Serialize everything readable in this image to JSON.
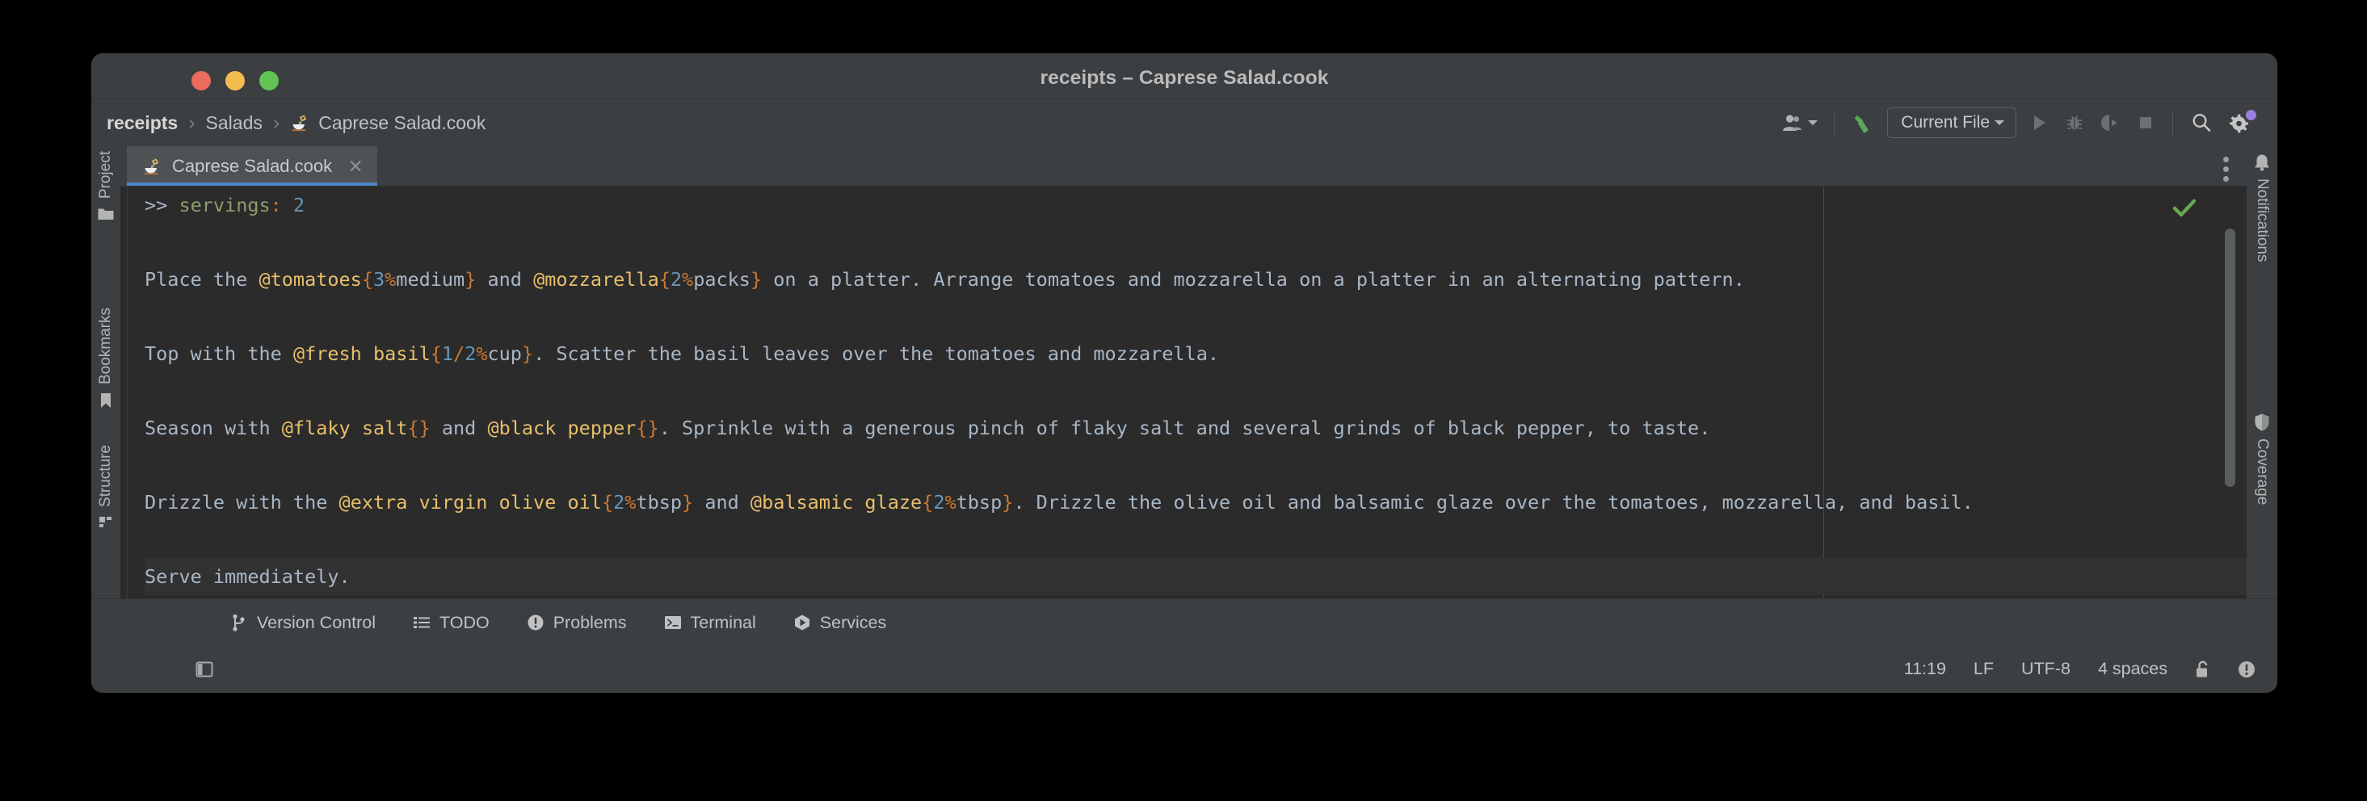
{
  "window": {
    "title": "receipts – Caprese Salad.cook",
    "controls": {
      "close": "close",
      "minimize": "minimize",
      "maximize": "maximize"
    }
  },
  "breadcrumb": {
    "items": [
      {
        "label": "receipts",
        "bold": true
      },
      {
        "label": "Salads",
        "bold": false
      },
      {
        "label": "Caprese Salad.cook",
        "bold": false,
        "icon": "cook-file-icon"
      }
    ],
    "separator": "›"
  },
  "toolbar": {
    "user_icon": "user-avatar-icon",
    "build_icon": "build-hammer-icon",
    "run_config": "Current File",
    "run_icon": "run-play-icon",
    "debug_icon": "debug-bug-icon",
    "coverage_icon": "run-with-coverage-icon",
    "stop_icon": "stop-square-icon",
    "search_icon": "search-icon",
    "settings_icon": "settings-gear-icon",
    "settings_badge_color": "#9a7de0"
  },
  "left_stripe": {
    "items": [
      {
        "label": "Project",
        "icon": "project-folder-icon"
      },
      {
        "label": "Bookmarks",
        "icon": "bookmark-icon"
      },
      {
        "label": "Structure",
        "icon": "structure-icon"
      }
    ]
  },
  "right_stripe": {
    "items": [
      {
        "label": "Notifications",
        "icon": "notification-bell-icon"
      },
      {
        "label": "Coverage",
        "icon": "coverage-shield-icon"
      }
    ]
  },
  "tabs": {
    "active": {
      "label": "Caprese Salad.cook",
      "icon": "cook-file-icon",
      "close": "✕"
    },
    "more_options": "tab-more-options-icon",
    "underline_color": "#4a88c7"
  },
  "editor": {
    "inspection_status": "ok",
    "inspection_color": "#6aa84f",
    "lines": [
      [
        {
          "t": ">> ",
          "c": "txt"
        },
        {
          "t": "servings",
          "c": "kw"
        },
        {
          "t": ":",
          "c": "punct"
        },
        {
          "t": " ",
          "c": "txt"
        },
        {
          "t": "2",
          "c": "num"
        }
      ],
      [],
      [
        {
          "t": "Place the ",
          "c": "txt"
        },
        {
          "t": "@tomatoes",
          "c": "ing"
        },
        {
          "t": "{",
          "c": "punct"
        },
        {
          "t": "3",
          "c": "num"
        },
        {
          "t": "%",
          "c": "punct"
        },
        {
          "t": "medium",
          "c": "txt"
        },
        {
          "t": "}",
          "c": "punct"
        },
        {
          "t": " and ",
          "c": "txt"
        },
        {
          "t": "@mozzarella",
          "c": "ing"
        },
        {
          "t": "{",
          "c": "punct"
        },
        {
          "t": "2",
          "c": "num"
        },
        {
          "t": "%",
          "c": "punct"
        },
        {
          "t": "packs",
          "c": "txt"
        },
        {
          "t": "}",
          "c": "punct"
        },
        {
          "t": " on a platter. Arrange tomatoes and mozzarella on a platter in an alternating pattern.",
          "c": "txt"
        }
      ],
      [],
      [
        {
          "t": "Top with the ",
          "c": "txt"
        },
        {
          "t": "@fresh basil",
          "c": "ing"
        },
        {
          "t": "{",
          "c": "punct"
        },
        {
          "t": "1",
          "c": "num"
        },
        {
          "t": "/",
          "c": "punct"
        },
        {
          "t": "2",
          "c": "num"
        },
        {
          "t": "%",
          "c": "punct"
        },
        {
          "t": "cup",
          "c": "txt"
        },
        {
          "t": "}",
          "c": "punct"
        },
        {
          "t": ". Scatter the basil leaves over the tomatoes and mozzarella.",
          "c": "txt"
        }
      ],
      [],
      [
        {
          "t": "Season with ",
          "c": "txt"
        },
        {
          "t": "@flaky salt",
          "c": "ing"
        },
        {
          "t": "{}",
          "c": "punct"
        },
        {
          "t": " and ",
          "c": "txt"
        },
        {
          "t": "@black pepper",
          "c": "ing"
        },
        {
          "t": "{}",
          "c": "punct"
        },
        {
          "t": ". Sprinkle with a generous pinch of flaky salt and several grinds of black pepper, to taste.",
          "c": "txt"
        }
      ],
      [],
      [
        {
          "t": "Drizzle with the ",
          "c": "txt"
        },
        {
          "t": "@extra virgin olive oil",
          "c": "ing"
        },
        {
          "t": "{",
          "c": "punct"
        },
        {
          "t": "2",
          "c": "num"
        },
        {
          "t": "%",
          "c": "punct"
        },
        {
          "t": "tbsp",
          "c": "txt"
        },
        {
          "t": "}",
          "c": "punct"
        },
        {
          "t": " and ",
          "c": "txt"
        },
        {
          "t": "@balsamic glaze",
          "c": "ing"
        },
        {
          "t": "{",
          "c": "punct"
        },
        {
          "t": "2",
          "c": "num"
        },
        {
          "t": "%",
          "c": "punct"
        },
        {
          "t": "tbsp",
          "c": "txt"
        },
        {
          "t": "}",
          "c": "punct"
        },
        {
          "t": ". Drizzle the olive oil and balsamic glaze over the tomatoes, mozzarella, and basil.",
          "c": "txt"
        }
      ],
      [],
      [
        {
          "t": "Serve immediately.",
          "c": "txt"
        }
      ]
    ],
    "current_line_index": 10
  },
  "bottom_bar": {
    "items": [
      {
        "label": "Version Control",
        "icon": "version-control-branch-icon"
      },
      {
        "label": "TODO",
        "icon": "todo-list-icon"
      },
      {
        "label": "Problems",
        "icon": "problems-warning-icon"
      },
      {
        "label": "Terminal",
        "icon": "terminal-prompt-icon"
      },
      {
        "label": "Services",
        "icon": "services-play-icon"
      }
    ]
  },
  "status_bar": {
    "left_icon": "toggle-tool-window-icon",
    "position": "11:19",
    "line_separator": "LF",
    "encoding": "UTF-8",
    "indent": "4 spaces",
    "lock_icon": "unlocked-padlock-icon",
    "inspection_icon": "inspection-info-icon"
  }
}
